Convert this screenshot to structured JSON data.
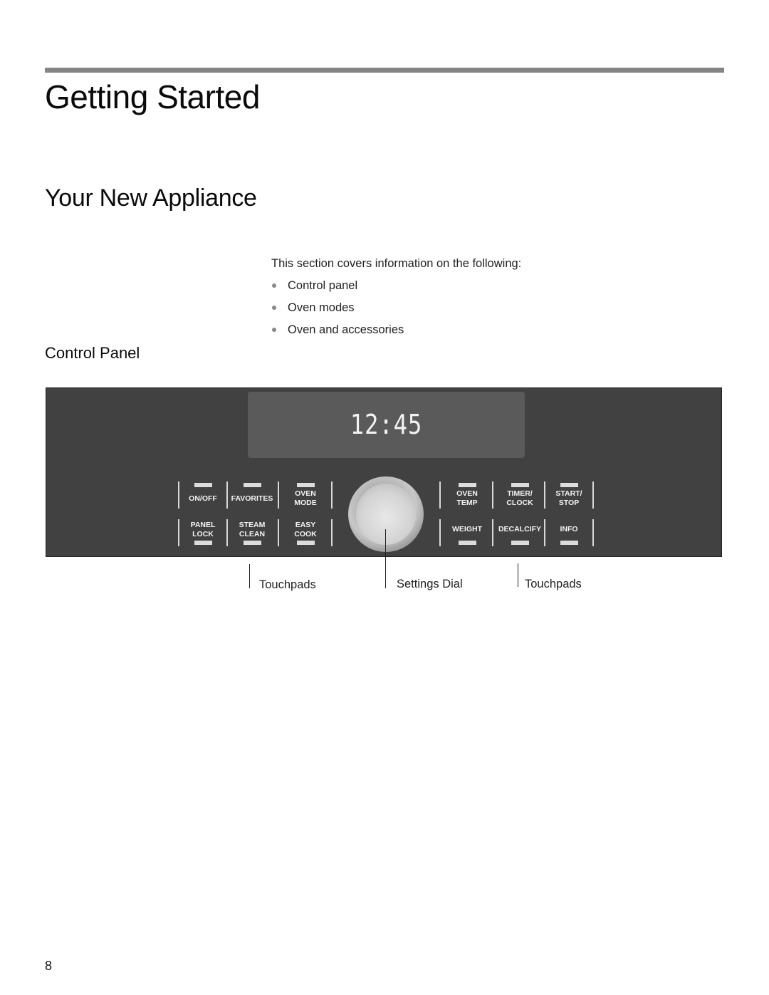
{
  "page": {
    "section_title": "Getting Started",
    "subsection_title": "Your New Appliance",
    "intro": "This section covers information on the following:",
    "topics": [
      "Control panel",
      "Oven modes",
      "Oven and accessories"
    ],
    "control_panel_heading": "Control Panel",
    "page_number": "8"
  },
  "panel": {
    "display_time": "12:45",
    "left_keys_top": [
      {
        "label": "ON/OFF"
      },
      {
        "label": "FAVORITES"
      },
      {
        "label": "OVEN\nMODE"
      }
    ],
    "left_keys_bottom": [
      {
        "label": "PANEL\nLOCK"
      },
      {
        "label": "STEAM\nCLEAN"
      },
      {
        "label": "EASY\nCOOK"
      }
    ],
    "right_keys_top": [
      {
        "label": "OVEN\nTEMP"
      },
      {
        "label": "TIMER/\nCLOCK"
      },
      {
        "label": "START/\nSTOP"
      }
    ],
    "right_keys_bottom": [
      {
        "label": "WEIGHT"
      },
      {
        "label": "DECALCIFY"
      },
      {
        "label": "INFO"
      }
    ]
  },
  "callouts": {
    "left": "Touchpads",
    "center": "Settings Dial",
    "right": "Touchpads"
  }
}
